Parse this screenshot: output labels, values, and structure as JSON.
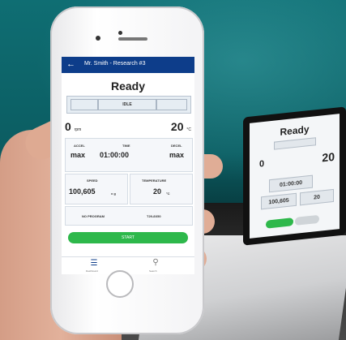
{
  "phone": {
    "topbar": {
      "back_icon": "arrow-left-icon",
      "title": "Mr. Smith - Research #3"
    },
    "status": {
      "title": "Ready",
      "state": "IDLE"
    },
    "live": {
      "speed_value": "0",
      "speed_unit": "rpm",
      "temp_value": "20",
      "temp_unit": "°C"
    },
    "settings": {
      "accel_label": "ACCEL",
      "accel_value": "max",
      "time_label": "TIME",
      "time_value": "01:00:00",
      "decel_label": "DECEL",
      "decel_value": "max",
      "speed_label": "SPEED",
      "speed_value": "100,605",
      "speed_unit": "x g",
      "temperature_label": "TEMPERATURE",
      "temperature_value": "20",
      "temperature_unit": "°C",
      "program_label": "NO PROGRAM",
      "rotor_label": "T29-8X50"
    },
    "actions": {
      "start_label": "START"
    },
    "nav": {
      "home_label": "Dashboard",
      "search_label": "Search"
    }
  },
  "device": {
    "title": "Ready",
    "speed_value": "0",
    "temp_value": "20",
    "time_value": "01:00:00",
    "speed_setting": "100,605",
    "temp_setting": "20"
  },
  "colors": {
    "accent": "#0d3d8a",
    "start": "#2eb84b",
    "wall": "#0f6e73"
  }
}
